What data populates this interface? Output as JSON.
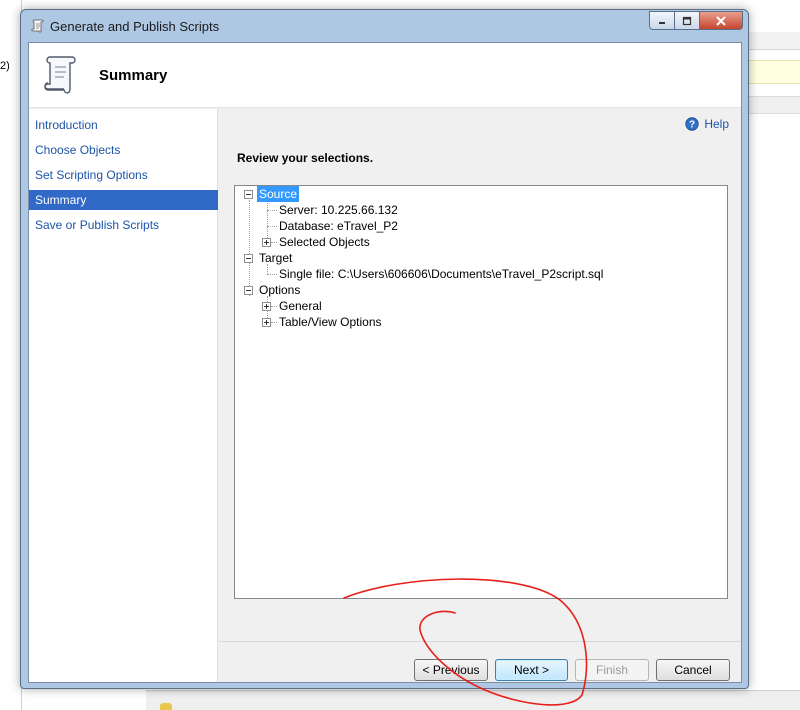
{
  "background": {
    "left_fragment": "2)"
  },
  "window": {
    "title": "Generate and Publish Scripts",
    "controls": [
      "minimize",
      "maximize",
      "close"
    ]
  },
  "header": {
    "title": "Summary"
  },
  "nav": {
    "items": [
      {
        "label": "Introduction",
        "active": false
      },
      {
        "label": "Choose Objects",
        "active": false
      },
      {
        "label": "Set Scripting Options",
        "active": false
      },
      {
        "label": "Summary",
        "active": true
      },
      {
        "label": "Save or Publish Scripts",
        "active": false
      }
    ]
  },
  "main": {
    "help_label": "Help",
    "heading": "Review your selections.",
    "tree": {
      "source": "Source",
      "server": "Server: 10.225.66.132",
      "database": "Database: eTravel_P2",
      "selected_objects": "Selected Objects",
      "target": "Target",
      "single_file": "Single file: C:\\Users\\606606\\Documents\\eTravel_P2script.sql",
      "options": "Options",
      "general": "General",
      "table_view_options": "Table/View Options"
    }
  },
  "buttons": {
    "previous": "< Previous",
    "next": "Next >",
    "finish": "Finish",
    "cancel": "Cancel"
  },
  "colors": {
    "accent": "#3169c6",
    "link": "#1c54a8",
    "selection": "#3399ff",
    "annotation": "#e8201c"
  }
}
